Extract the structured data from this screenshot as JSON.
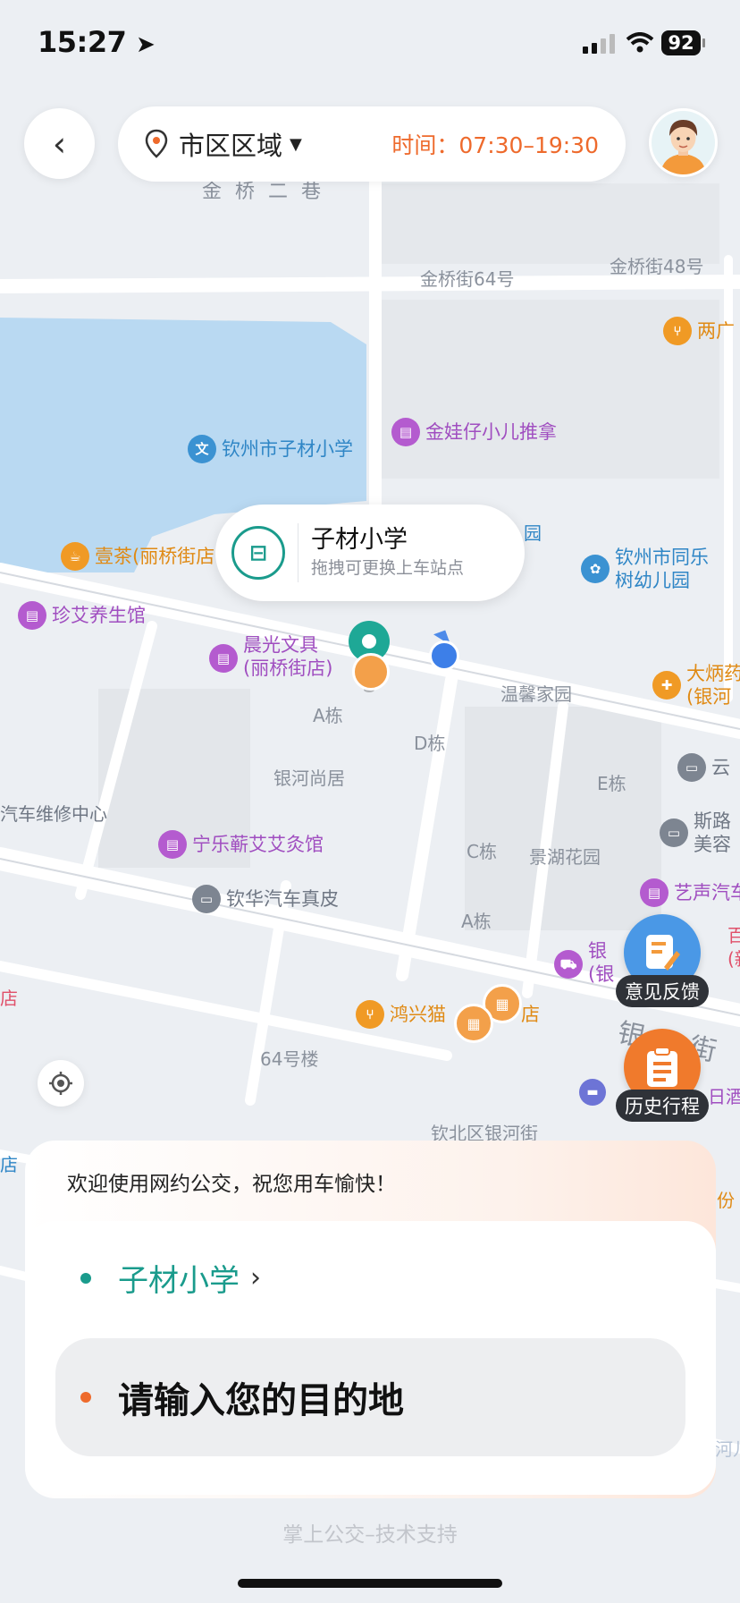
{
  "status_bar": {
    "time": "15:27",
    "battery": "92"
  },
  "top_bar": {
    "region_label": "市区区域",
    "time_label": "时间：",
    "time_value": "07:30–19:30"
  },
  "colors": {
    "accent_teal": "#1a9b8c",
    "accent_orange": "#ee6a2c",
    "user_dot": "#3d7fe8"
  },
  "map": {
    "pois": [
      {
        "text": "两广",
        "kind": "orange",
        "icon": "fork-knife-icon"
      },
      {
        "text": "金娃仔小儿推拿",
        "kind": "purple",
        "icon": "shop-icon"
      },
      {
        "text": "钦州市子材小学",
        "kind": "blue",
        "icon": "school-icon"
      },
      {
        "text": "钦州市同乐",
        "text2": "树幼儿园",
        "kind": "blue",
        "icon": "sprout-icon"
      },
      {
        "text": "壹茶(丽桥街店",
        "kind": "orange",
        "icon": "cup-icon"
      },
      {
        "text": "珍艾养生馆",
        "kind": "purple",
        "icon": "shop-icon"
      },
      {
        "text": "晨光文具",
        "text2": "(丽桥街店)",
        "kind": "purple",
        "icon": "shop-icon"
      },
      {
        "text": "大炳药",
        "text2": "(银河",
        "kind": "orange",
        "icon": "pill-icon"
      },
      {
        "text": "云",
        "kind": "grey",
        "icon": "car-icon"
      },
      {
        "text": "斯路",
        "text2": "美容",
        "kind": "grey",
        "icon": "car-icon"
      },
      {
        "text": "宁乐蕲艾艾灸馆",
        "kind": "purple",
        "icon": "shop-icon"
      },
      {
        "text": "钦华汽车真皮",
        "kind": "grey",
        "icon": "car-icon"
      },
      {
        "text": "艺声汽车",
        "kind": "purple",
        "icon": "shop-icon"
      },
      {
        "text": "银",
        "text2": "(银",
        "kind": "purple",
        "icon": "cart-icon"
      },
      {
        "text": "鸿兴猫",
        "text2": "店",
        "kind": "orange",
        "icon": "fork-knife-icon"
      }
    ],
    "labels": {
      "jinqiao_lane": "金 桥 二 巷",
      "jqj64": "金桥街64号",
      "jqj48": "金桥街48号",
      "yuan_partial": "园",
      "wenxin": "温馨家园",
      "a_dong": "A栋",
      "d_dong": "D栋",
      "yinhe_shangju": "银河尚居",
      "car_repair": "汽车维修中心",
      "e_dong": "E栋",
      "c_dong": "C栋",
      "jinghu": "景湖花园",
      "a_dong2": "A栋",
      "no64": "64号楼",
      "yinhe_street": "钦北区银河街",
      "yin_big": "银",
      "jie_big": "街",
      "ri_partial": "日酒",
      "dian_left": "店",
      "dian_left2": "店",
      "bai_partial": "百",
      "xin_partial": "(新",
      "fen_partial": "份",
      "er_partial": "河儿"
    },
    "bubble": {
      "title": "子材小学",
      "subtitle": "拖拽可更换上车站点"
    }
  },
  "floating": {
    "feedback_label": "意见反馈",
    "history_label": "历史行程"
  },
  "sheet": {
    "welcome": "欢迎使用网约公交，祝您用车愉快！",
    "origin": "子材小学",
    "origin_chevron": "›",
    "destination_placeholder": "请输入您的目的地"
  },
  "footer": {
    "support": "掌上公交–技术支持"
  }
}
